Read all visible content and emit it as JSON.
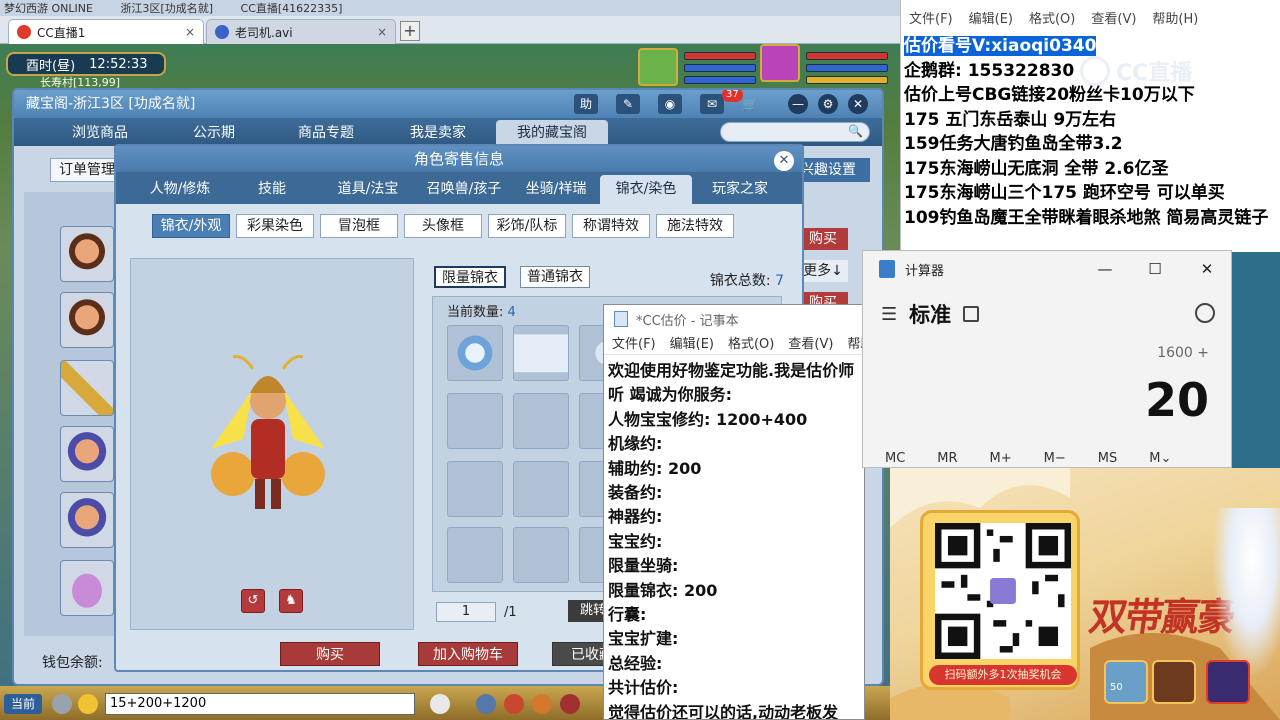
{
  "os_top": {
    "items": [
      "梦幻西游 ONLINE",
      "浙江3区[功成名就]",
      "CC直播[41622335]"
    ]
  },
  "browser": {
    "tabs": [
      {
        "label": "CC直播1",
        "active": true
      },
      {
        "label": "老司机.avi",
        "active": false
      }
    ],
    "add_label": "+",
    "close_label": "×"
  },
  "game": {
    "time_label": "酉时(昼)",
    "clock": "12:52:33",
    "location": "长寿村[113,99]",
    "chat_channel": "当前",
    "chat_input": "15+200+1200"
  },
  "cbg": {
    "title": "藏宝阁-浙江3区 [功成名就]",
    "help_label": "助",
    "message_badge": "37",
    "nav": [
      "浏览商品",
      "公示期",
      "商品专题",
      "我是卖家",
      "我的藏宝阁"
    ],
    "active_nav": 4,
    "order_label": "订单管理",
    "interest_label": "兴趣设置",
    "side_buy_label": "购买",
    "side_more_label": "更多↓",
    "wallet_label": "钱包余额:"
  },
  "modal": {
    "title": "角色寄售信息",
    "close_label": "✕",
    "tabs": [
      "人物/修炼",
      "技能",
      "道具/法宝",
      "召唤兽/孩子",
      "坐骑/祥瑞",
      "锦衣/染色",
      "玩家之家"
    ],
    "active_tab": 5,
    "subtabs": [
      "锦衣/外观",
      "彩果染色",
      "冒泡框",
      "头像框",
      "彩饰/队标",
      "称谓特效",
      "施法特效"
    ],
    "active_subtab": 0,
    "wardrobe_tabs": [
      "限量锦衣",
      "普通锦衣"
    ],
    "total_label": "锦衣总数:",
    "total_value": "7",
    "count_label": "当前数量:",
    "count_value": "4",
    "page_current": "1",
    "page_total": "/1",
    "jump_label": "跳转",
    "buy_label": "购买",
    "cart_label": "加入购物车",
    "fav_label": "已收藏",
    "rotate_icon_label": "↺",
    "action_icon_label": "♞"
  },
  "note_small": {
    "title": "*CC估价 - 记事本",
    "menu": [
      "文件(F)",
      "编辑(E)",
      "格式(O)",
      "查看(V)",
      "帮助"
    ],
    "lines": [
      "欢迎使用好物鉴定功能.我是估价师",
      "听 竭诚为你服务:",
      "人物宝宝修约: 1200+400",
      "机缘约:",
      "辅助约: 200",
      "装备约:",
      "神器约:",
      "宝宝约:",
      "限量坐骑:",
      "限量锦衣: 200",
      "行囊:",
      "宝宝扩建:",
      "总经验:",
      "共计估价:",
      "觉得估价还可以的话,动动老板发"
    ]
  },
  "note_big": {
    "menu": [
      "文件(F)",
      "编辑(E)",
      "格式(O)",
      "查看(V)",
      "帮助(H)"
    ],
    "selected_line": "估价看号V:xiaoqi0340",
    "lines": [
      "企鹅群: 155322830",
      "估价上号CBG链接20粉丝卡10万以下",
      "175 五门东岳泰山 9万左右",
      "159任务大唐钓鱼岛全带3.2",
      "175东海崂山无底洞 全带 2.6亿圣",
      "175东海崂山三个175 跑环空号 可以单买",
      "109钓鱼岛魔王全带眯着眼杀地煞 简易高灵链子"
    ],
    "watermark": "CC直播"
  },
  "calculator": {
    "title": "计算器",
    "mode": "标准",
    "expression": "1600 +",
    "display": "20",
    "memory": [
      "MC",
      "MR",
      "M+",
      "M−",
      "MS",
      "M⌄"
    ],
    "min_label": "—",
    "max_label": "☐",
    "close_label": "✕",
    "menu_icon": "☰"
  },
  "promo": {
    "qr_caption": "扫码额外多1次抽奖机会",
    "title": "双带赢豪",
    "item_count_label": "50"
  },
  "colors": {
    "cbg_blue": "#4f82b4",
    "buy_red": "#a83a3a",
    "selection_blue": "#0a64d8"
  }
}
